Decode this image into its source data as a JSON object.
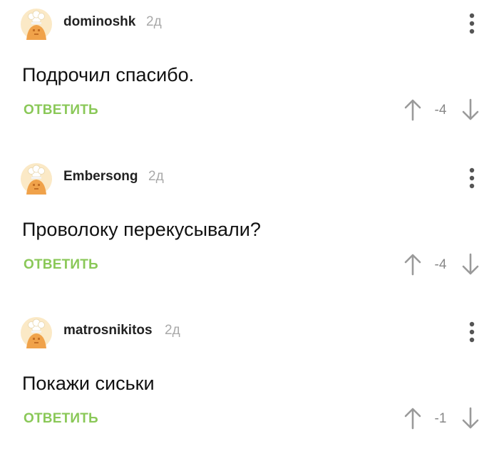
{
  "comments": [
    {
      "username": "dominoshk",
      "time": "2д",
      "text": "Подрочил спасибо.",
      "reply_label": "ОТВЕТИТЬ",
      "rating": "-4",
      "avatar_icon": "chef-hat-avatar-icon",
      "menu_icon": "more-vertical-icon"
    },
    {
      "username": "Embersong",
      "time": "2д",
      "text": "Проволоку перекусывали?",
      "reply_label": "ОТВЕТИТЬ",
      "rating": "-4",
      "avatar_icon": "chef-hat-avatar-icon",
      "menu_icon": "more-vertical-icon"
    },
    {
      "username": "matrosnikitos",
      "time": "2д",
      "text": "Покажи сиськи",
      "reply_label": "ОТВЕТИТЬ",
      "rating": "-1",
      "avatar_icon": "chef-hat-avatar-icon",
      "menu_icon": "more-vertical-icon"
    }
  ],
  "colors": {
    "reply": "#8ac858",
    "time": "#a9a9a9",
    "rating": "#888888",
    "arrows": "#9a9a9a",
    "avatar_bg": "#fbe9c6",
    "avatar_face": "#f0a24a"
  }
}
